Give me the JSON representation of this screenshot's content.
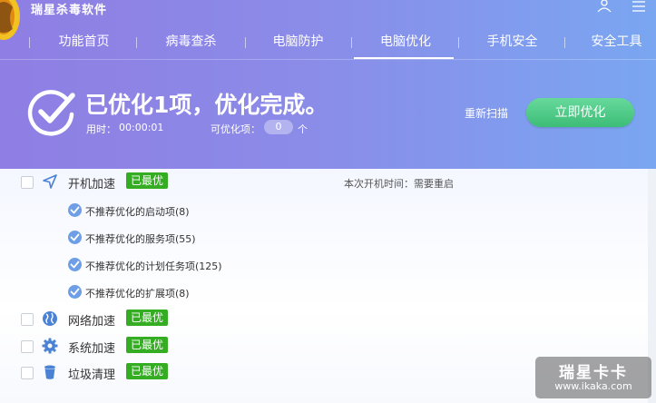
{
  "app": {
    "title": "瑞星杀毒软件"
  },
  "nav": {
    "tabs": [
      {
        "label": "功能首页"
      },
      {
        "label": "病毒查杀"
      },
      {
        "label": "电脑防护"
      },
      {
        "label": "电脑优化",
        "active": true
      },
      {
        "label": "手机安全"
      },
      {
        "label": "安全工具"
      }
    ]
  },
  "status": {
    "title": "已优化1项，优化完成。",
    "elapsed_label": "用时：",
    "elapsed_value": "00:00:01",
    "optimizable_label": "可优化项：",
    "optimizable_count": "0",
    "optimizable_unit": "个"
  },
  "actions": {
    "rescan_label": "重新扫描",
    "optimize_label": "立即优化"
  },
  "items": [
    {
      "label": "开机加速",
      "badge": "已最优",
      "icon": "send-arrow-icon",
      "boot_time": "本次开机时间：需要重启",
      "subitems": [
        "不推荐优化的启动项(8)",
        "不推荐优化的服务项(55)",
        "不推荐优化的计划任务项(125)",
        "不推荐优化的扩展项(8)"
      ]
    },
    {
      "label": "网络加速",
      "badge": "已最优",
      "icon": "globe-icon"
    },
    {
      "label": "系统加速",
      "badge": "已最优",
      "icon": "gear-icon"
    },
    {
      "label": "垃圾清理",
      "badge": "已最优",
      "icon": "trash-can-icon"
    }
  ],
  "watermark": {
    "name": "瑞星卡卡",
    "url": "www.ikaka.com"
  },
  "colors": {
    "header_start": "#8f7ee3",
    "header_end": "#7aa6f1",
    "badge_green": "#35ad23",
    "button_green": "#3dbd77",
    "check_blue": "#6d9ee6"
  }
}
